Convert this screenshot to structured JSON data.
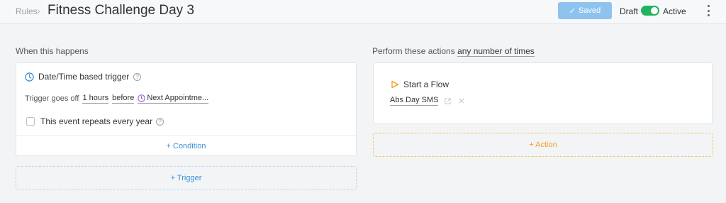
{
  "header": {
    "breadcrumb": "Rules",
    "breadcrumb_sep": "›",
    "title": "Fitness Challenge Day 3",
    "saved_label": "Saved",
    "draft_label": "Draft",
    "active_label": "Active"
  },
  "left": {
    "section_label": "When this happens",
    "trigger_title": "Date/Time based trigger",
    "trigger_text": "Trigger goes off",
    "trigger_amount": "1 hours",
    "trigger_when": "before",
    "trigger_event": "Next Appointme...",
    "repeat_label": "This event repeats every year",
    "condition_link": "+ Condition",
    "add_trigger": "+ Trigger"
  },
  "right": {
    "section_label_prefix": "Perform these actions",
    "section_label_value": "any number of times",
    "action_title": "Start a Flow",
    "flow_name": "Abs Day SMS",
    "add_action": "+ Action"
  },
  "colors": {
    "accent_blue": "#3a8fd8",
    "saved_btn": "#8ec3ef",
    "toggle_green": "#22b35f",
    "action_orange": "#f0a020"
  }
}
